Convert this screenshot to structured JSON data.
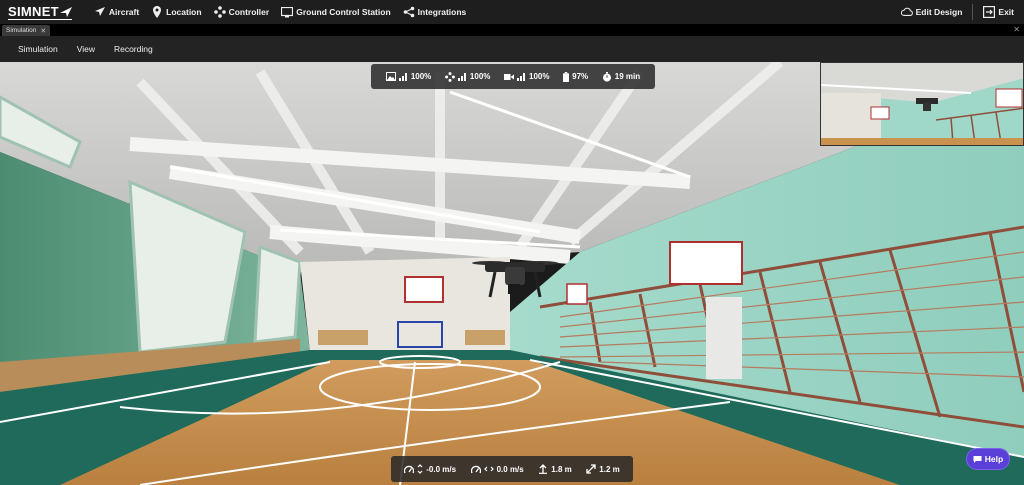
{
  "app": {
    "logo": "SIMNET",
    "nav": [
      {
        "label": "Aircraft",
        "icon": "airplane-icon"
      },
      {
        "label": "Location",
        "icon": "location-pin-icon"
      },
      {
        "label": "Controller",
        "icon": "dpad-icon"
      },
      {
        "label": "Ground Control Station",
        "icon": "monitor-icon"
      },
      {
        "label": "Integrations",
        "icon": "share-icon"
      }
    ],
    "edit_design": "Edit Design",
    "exit": "Exit"
  },
  "tabs": {
    "active": "Simulation",
    "close_glyph": "✕"
  },
  "menu": [
    "Simulation",
    "View",
    "Recording"
  ],
  "telemetry": {
    "video_signal": "100%",
    "control_signal": "100%",
    "camera_signal": "100%",
    "battery": "97%",
    "flight_time": "19 min"
  },
  "bottom": {
    "vertical_speed": "-0.0 m/s",
    "horizontal_speed": "0.0 m/s",
    "altitude": "1.8 m",
    "distance": "1.2 m"
  },
  "help": "Help",
  "colors": {
    "help_button": "#5b3fd9",
    "court_floor": "#c8924f",
    "court_green": "#1f6a5a",
    "wall_mint": "#9fd8c8"
  }
}
